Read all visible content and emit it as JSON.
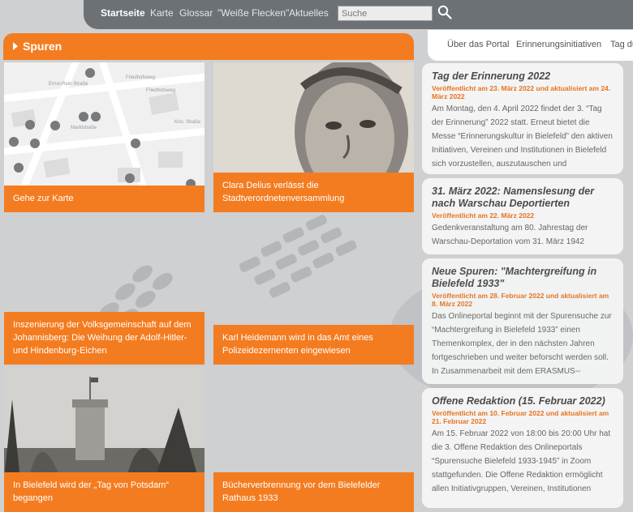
{
  "nav": {
    "items": [
      "Startseite",
      "Karte",
      "Glossar",
      "\"Weiße Flecken\"",
      "Aktuelles"
    ],
    "search_placeholder": "Suche"
  },
  "subnav": {
    "items": [
      "Über das Portal",
      "Erinnerungsinitiativen",
      "Tag du"
    ]
  },
  "spuren": {
    "title": "Spuren",
    "tiles": [
      {
        "caption": "Gehe zur Karte"
      },
      {
        "caption": "Clara Delius verlässt die Stadtverordnetenversammlung"
      },
      {
        "caption": "Inszenierung der Volksgemeinschaft auf dem Johannisberg: Die Weihung der Adolf-Hitler- und Hindenburg-Eichen"
      },
      {
        "caption": "Karl Heidemann wird in das Amt eines Polizeidezernenten eingewiesen"
      },
      {
        "caption": "In Bielefeld wird der „Tag von Potsdam“ begangen"
      },
      {
        "caption": "Bücherverbrennung vor dem Bielefelder Rathaus 1933"
      }
    ]
  },
  "map_labels": [
    "Ernst-Rein-Straße",
    "Friedhofsweg",
    "Marktstraße",
    "Kno. Straße",
    "Friedhofsweg"
  ],
  "news": [
    {
      "title": "Tag der Erinnerung 2022",
      "date": "Veröffentlicht am 23. März 2022 und aktualisiert am 24. März 2022",
      "text": "Am Montag, den 4. April 2022 findet der 3. “Tag der Erinnerung” 2022 statt. Erneut bietet die Messe “Erinnerungskultur in Bielefeld” den aktiven Initiativen, Vereinen und Institutionen in Bielefeld sich vorzustellen, auszutauschen und"
    },
    {
      "title": "31. März 2022: Namenslesung der nach Warschau Deportierten",
      "date": "Veröffentlicht am 22. März 2022",
      "text": "Gedenkveranstaltung am 80. Jahrestag der Warschau-Deportation vom 31. März 1942"
    },
    {
      "title": "Neue Spuren: \"Machtergreifung in Bielefeld 1933\"",
      "date": "Veröffentlicht am 28. Februar 2022 und aktualisiert am 8. März 2022",
      "text": "Das Onlineportal beginnt mit der Spurensuche zur “Machtergreifung in Bielefeld 1933” einen Themenkomplex, der in den nächsten Jahren fortgeschrieben und weiter beforscht werden soll. In Zusammenarbeit mit dem ERASMUS--"
    },
    {
      "title": "Offene Redaktion (15. Februar 2022)",
      "date": "Veröffentlicht am 10. Februar 2022 und aktualisiert am 21. Februar 2022",
      "text": "Am 15. Februar 2022 von 18:00 bis 20:00 Uhr hat die 3. Offene Redaktion des Onlineportals “Spurensuche Bielefeld 1933-1945” in Zoom stattgefunden. Die Offene Redaktion ermöglicht allen Initiativgruppen, Vereinen, Institutionen"
    }
  ],
  "colors": {
    "accent": "#f47c20",
    "nav_bg": "#6c7175",
    "page_bg": "#cfd0d2",
    "date_text": "#e8731e"
  }
}
